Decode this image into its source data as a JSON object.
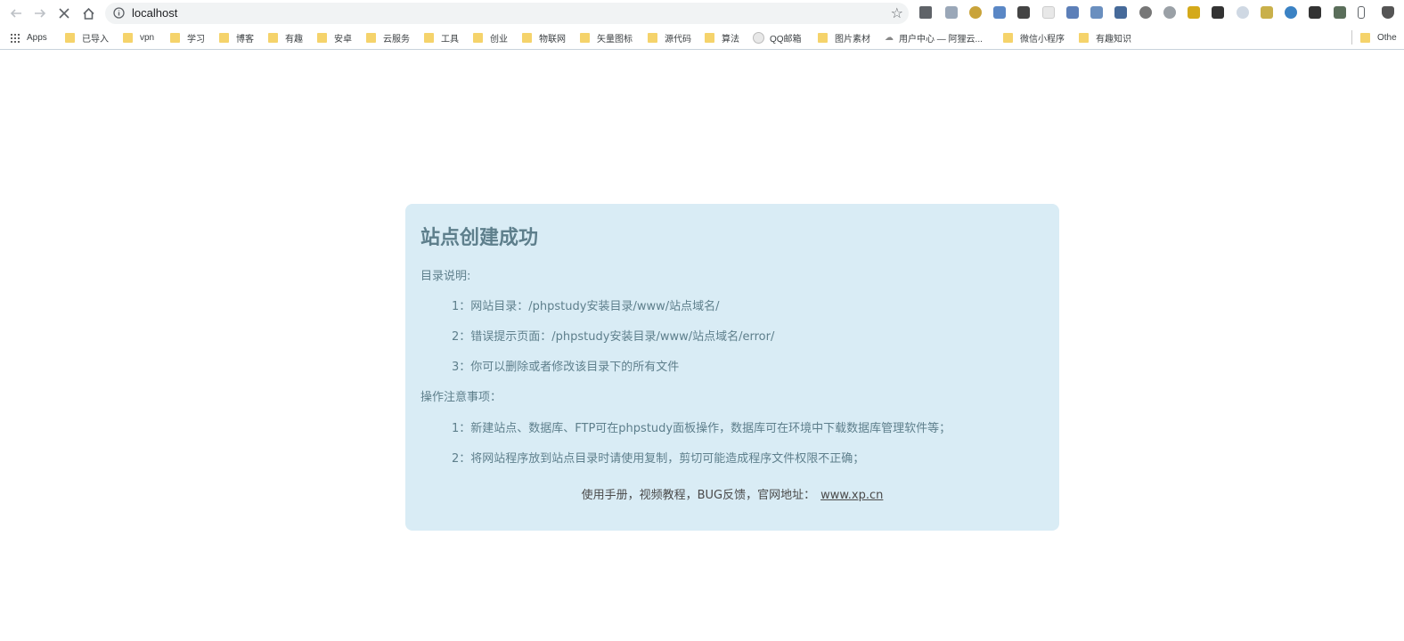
{
  "browser": {
    "url": "localhost"
  },
  "bookmarks": [
    {
      "label": "Apps",
      "icon": "apps-grid-icon"
    },
    {
      "label": "已导入",
      "icon": "folder-icon"
    },
    {
      "label": "vpn",
      "icon": "folder-icon"
    },
    {
      "label": "学习",
      "icon": "folder-icon"
    },
    {
      "label": "博客",
      "icon": "folder-icon"
    },
    {
      "label": "有趣",
      "icon": "folder-icon"
    },
    {
      "label": "安卓",
      "icon": "folder-icon"
    },
    {
      "label": "云服务",
      "icon": "folder-icon"
    },
    {
      "label": "工具",
      "icon": "folder-icon"
    },
    {
      "label": "创业",
      "icon": "folder-icon"
    },
    {
      "label": "物联网",
      "icon": "folder-icon"
    },
    {
      "label": "矢量图标",
      "icon": "folder-icon"
    },
    {
      "label": "源代码",
      "icon": "folder-icon"
    },
    {
      "label": "算法",
      "icon": "folder-icon"
    },
    {
      "label": "QQ邮箱",
      "icon": "qq-mail-icon"
    },
    {
      "label": "图片素材",
      "icon": "folder-icon"
    },
    {
      "label": "用户中心 — 阿狸云...",
      "icon": "cloud-icon"
    },
    {
      "label": "微信小程序",
      "icon": "folder-icon"
    },
    {
      "label": "有趣知识",
      "icon": "folder-icon"
    },
    {
      "label": "Othe",
      "icon": "folder-icon"
    }
  ],
  "page": {
    "title": "站点创建成功",
    "dir_heading": "目录说明:",
    "dir_items": [
      "1：网站目录：/phpstudy安装目录/www/站点域名/",
      "2：错误提示页面：/phpstudy安装目录/www/站点域名/error/",
      "3：你可以删除或者修改该目录下的所有文件"
    ],
    "ops_heading": "操作注意事项：",
    "ops_items": [
      "1：新建站点、数据库、FTP可在phpstudy面板操作，数据库可在环境中下载数据库管理软件等；",
      "2：将网站程序放到站点目录时请使用复制，剪切可能造成程序文件权限不正确；"
    ],
    "footer_text": "使用手册，视频教程，BUG反馈，官网地址：",
    "footer_link": "www.xp.cn"
  },
  "colors": {
    "card_bg": "#d9ecf5",
    "card_text": "#5e7f8c",
    "folder": "#f5d36b"
  }
}
